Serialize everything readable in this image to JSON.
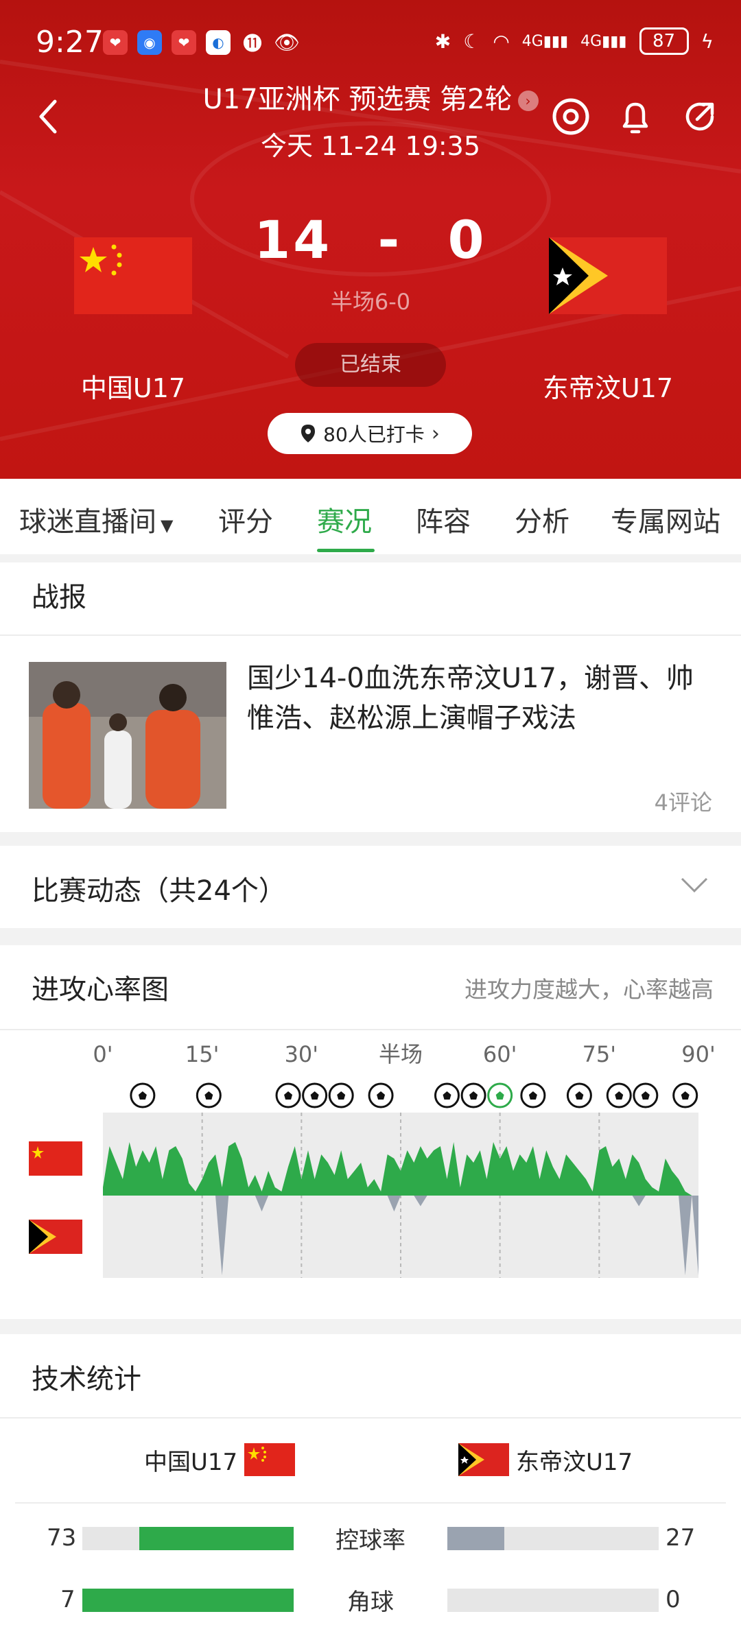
{
  "status_bar": {
    "time": "9:27",
    "battery": "87"
  },
  "header": {
    "title": "U17亚洲杯 预选赛 第2轮",
    "subtitle": "今天 11-24 19:35",
    "home_team": "中国U17",
    "away_team": "东帝汶U17",
    "home_score": "14",
    "away_score": "0",
    "score_sep": "-",
    "half_score": "半场6-0",
    "status": "已结束",
    "checkin": "80人已打卡"
  },
  "tabs": [
    {
      "label": "球迷直播间"
    },
    {
      "label": "评分"
    },
    {
      "label": "赛况"
    },
    {
      "label": "阵容"
    },
    {
      "label": "分析"
    },
    {
      "label": "专属网站"
    }
  ],
  "active_tab": "赛况",
  "report": {
    "title": "战报",
    "headline": "国少14-0血洗东帝汶U17，谢晋、帅惟浩、赵松源上演帽子戏法",
    "comments": "4评论"
  },
  "events": {
    "title": "比赛动态（共24个）"
  },
  "momentum": {
    "title": "进攻心率图",
    "note": "进攻力度越大，心率越高",
    "axis_labels": [
      "0'",
      "15'",
      "30'",
      "半场",
      "60'",
      "75'",
      "90'"
    ],
    "goal_minutes": [
      6,
      16,
      28,
      32,
      36,
      42,
      52,
      56,
      60,
      65,
      72,
      78,
      82,
      88
    ],
    "home": [
      10,
      60,
      40,
      20,
      65,
      35,
      55,
      40,
      60,
      20,
      55,
      60,
      45,
      15,
      5,
      20,
      40,
      50,
      10,
      60,
      65,
      45,
      10,
      25,
      5,
      30,
      10,
      5,
      35,
      60,
      20,
      55,
      20,
      50,
      40,
      25,
      55,
      20,
      30,
      40,
      10,
      20,
      5,
      50,
      45,
      30,
      55,
      40,
      60,
      45,
      55,
      60,
      20,
      65,
      10,
      50,
      40,
      55,
      20,
      65,
      45,
      60,
      30,
      50,
      40,
      60,
      20,
      55,
      35,
      20,
      50,
      40,
      30,
      20,
      5,
      55,
      60,
      35,
      45,
      20,
      50,
      40,
      20,
      10,
      5,
      45,
      30,
      20,
      5,
      0,
      0
    ],
    "away": [
      0,
      0,
      0,
      0,
      0,
      0,
      0,
      0,
      0,
      0,
      0,
      0,
      0,
      0,
      0,
      0,
      0,
      0,
      75,
      0,
      0,
      0,
      0,
      0,
      15,
      0,
      0,
      0,
      0,
      0,
      0,
      0,
      0,
      0,
      0,
      0,
      0,
      0,
      0,
      0,
      0,
      0,
      0,
      0,
      15,
      0,
      0,
      0,
      10,
      0,
      0,
      0,
      0,
      0,
      0,
      0,
      0,
      0,
      0,
      0,
      0,
      0,
      0,
      0,
      0,
      0,
      0,
      0,
      0,
      0,
      0,
      0,
      0,
      0,
      0,
      0,
      0,
      0,
      0,
      0,
      0,
      10,
      0,
      0,
      0,
      0,
      0,
      0,
      75,
      0,
      75
    ]
  },
  "stats": {
    "title": "技术统计",
    "home_team": "中国U17",
    "away_team": "东帝汶U17",
    "rows": [
      {
        "label": "控球率",
        "home": "73",
        "away": "27",
        "home_frac": 0.73,
        "away_frac": 0.27
      },
      {
        "label": "角球",
        "home": "7",
        "away": "0",
        "home_frac": 1.0,
        "away_frac": 0.0
      }
    ]
  },
  "colors": {
    "accent": "#2eaa4a",
    "header": "#c8181a",
    "away_bar": "#9aa3b0"
  }
}
